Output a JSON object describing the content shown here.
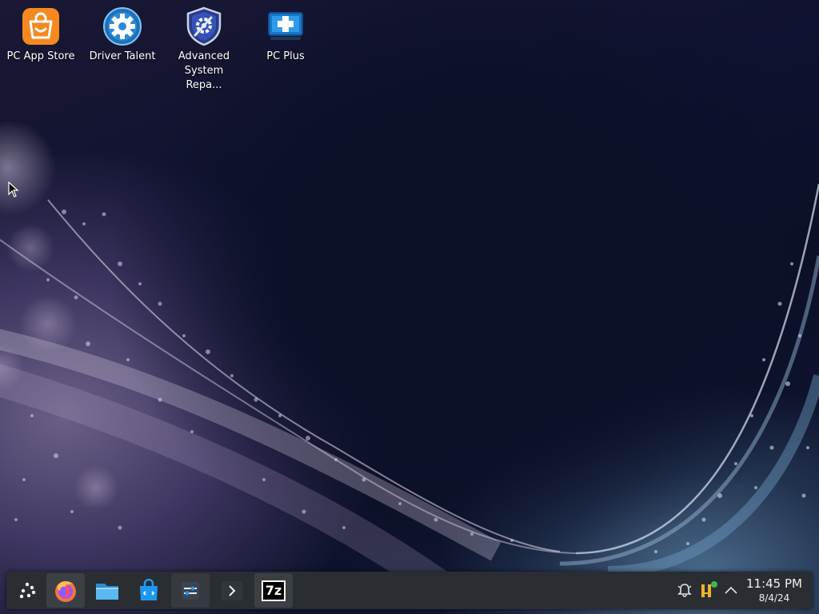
{
  "desktop": {
    "icons": [
      {
        "label": "PC App Store",
        "icon": "shopping-bag-icon"
      },
      {
        "label": "Driver Talent",
        "icon": "gear-icon"
      },
      {
        "label": "Advanced System Repa...",
        "icon": "shield-gear-icon"
      },
      {
        "label": "PC Plus",
        "icon": "monitor-plus-icon"
      }
    ]
  },
  "taskbar": {
    "pinned": [
      {
        "name": "application-launcher",
        "icon": "launcher-icon"
      },
      {
        "name": "firefox",
        "icon": "firefox-icon"
      },
      {
        "name": "file-manager",
        "icon": "folder-icon"
      },
      {
        "name": "discover-store",
        "icon": "store-bag-icon"
      },
      {
        "name": "system-settings",
        "icon": "settings-sliders-icon"
      },
      {
        "name": "terminal",
        "icon": "terminal-icon"
      },
      {
        "name": "7zip",
        "icon": "7zip-icon",
        "text": "7z"
      }
    ],
    "tray": [
      {
        "name": "notifications",
        "icon": "bell-icon"
      },
      {
        "name": "update-notifier",
        "icon": "updates-icon"
      },
      {
        "name": "show-hidden",
        "icon": "chevron-up-icon"
      }
    ],
    "clock": {
      "time": "11:45 PM",
      "date": "8/4/24"
    }
  },
  "colors": {
    "taskbar_bg": "#2a2e32",
    "accent_blue": "#2a8ad4",
    "orange": "#f5891f"
  }
}
